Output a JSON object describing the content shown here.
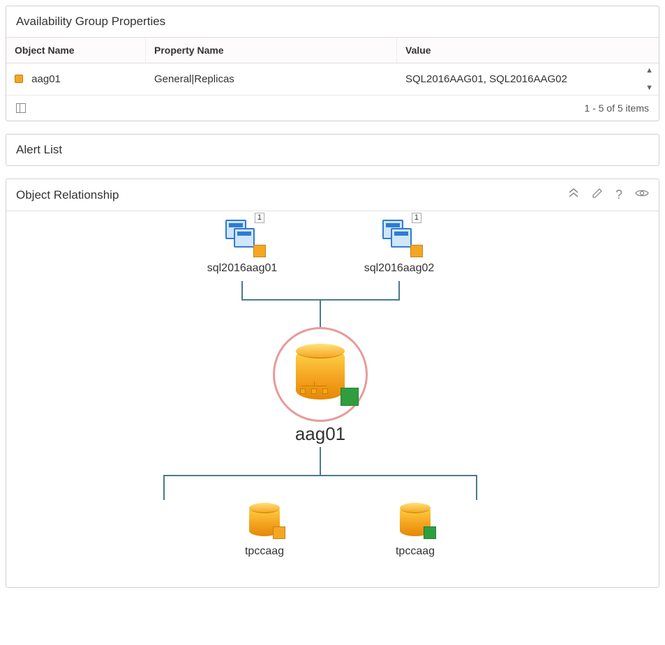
{
  "properties_panel": {
    "title": "Availability Group Properties",
    "columns": {
      "object": "Object Name",
      "property": "Property Name",
      "value": "Value"
    },
    "row": {
      "object": "aag01",
      "property": "General|Replicas",
      "value": "SQL2016AAG01, SQL2016AAG02"
    },
    "footer": "1 - 5 of 5 items"
  },
  "alert_panel": {
    "title": "Alert List"
  },
  "relationship_panel": {
    "title": "Object Relationship",
    "parents": [
      {
        "label": "sql2016aag01",
        "badge": "1"
      },
      {
        "label": "sql2016aag02",
        "badge": "1"
      }
    ],
    "center": {
      "label": "aag01"
    },
    "children": [
      {
        "label": "tpccaag"
      },
      {
        "label": "tpccaag"
      }
    ]
  }
}
